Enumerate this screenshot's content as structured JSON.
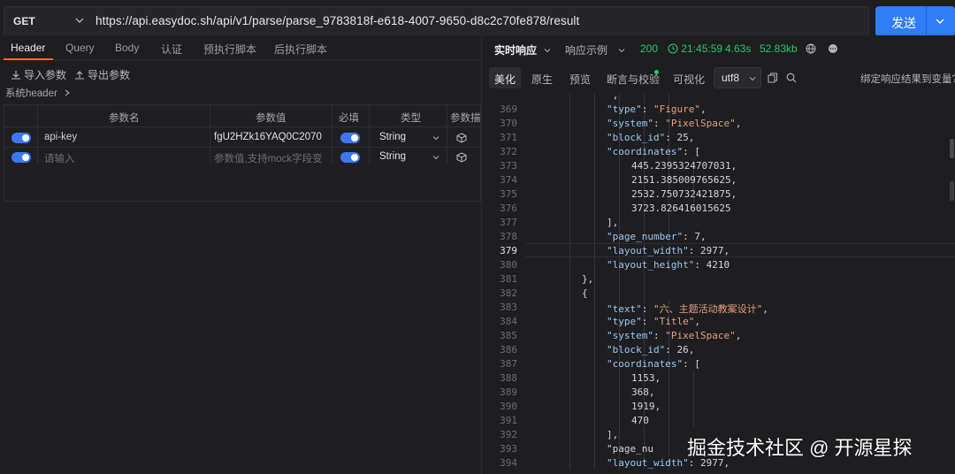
{
  "request": {
    "method": "GET",
    "url": "https://api.easydoc.sh/api/v1/parse/parse_9783818f-e618-4007-9650-d8c2c70fe878/result",
    "send_label": "发送"
  },
  "request_tabs": [
    "Header",
    "Query",
    "Body",
    "认证",
    "预执行脚本",
    "后执行脚本"
  ],
  "tools": {
    "import": "导入参数",
    "export": "导出参数"
  },
  "system_header": "系统header",
  "params_table": {
    "headers": [
      "参数名",
      "参数值",
      "必填",
      "类型",
      "参数描"
    ],
    "rows": [
      {
        "name": "api-key",
        "value": "fgU2HZk16YAQ0C2070",
        "required": true,
        "type": "String"
      },
      {
        "name": "请输入",
        "value": "参数值,支持mock字段变",
        "required": true,
        "type": "String"
      }
    ]
  },
  "response": {
    "mode": "实时响应",
    "example": "响应示例",
    "status": "200",
    "time": "21:45:59",
    "duration": "4.63s",
    "size": "52.83kb"
  },
  "view_tabs": [
    "美化",
    "原生",
    "预览",
    "断言与校验",
    "可视化"
  ],
  "encoding": "utf8",
  "bind_label": "绑定响应结果到变量?",
  "code": {
    "current_line": "379",
    "lines": [
      {
        "n": "",
        "t": "\","
      },
      {
        "n": "369",
        "t": "\"type\": \"Figure\","
      },
      {
        "n": "370",
        "t": "\"system\": \"PixelSpace\","
      },
      {
        "n": "371",
        "t": "\"block_id\": 25,"
      },
      {
        "n": "372",
        "t": "\"coordinates\": ["
      },
      {
        "n": "373",
        "t": "445.2395324707031,"
      },
      {
        "n": "374",
        "t": "2151.385009765625,"
      },
      {
        "n": "375",
        "t": "2532.750732421875,"
      },
      {
        "n": "376",
        "t": "3723.826416015625"
      },
      {
        "n": "377",
        "t": "],"
      },
      {
        "n": "378",
        "t": "\"page_number\": 7,"
      },
      {
        "n": "379",
        "t": "\"layout_width\": 2977,"
      },
      {
        "n": "380",
        "t": "\"layout_height\": 4210"
      },
      {
        "n": "381",
        "t": "},"
      },
      {
        "n": "382",
        "t": "{"
      },
      {
        "n": "383",
        "t": "\"text\": \"六、主题活动教案设计\","
      },
      {
        "n": "384",
        "t": "\"type\": \"Title\","
      },
      {
        "n": "385",
        "t": "\"system\": \"PixelSpace\","
      },
      {
        "n": "386",
        "t": "\"block_id\": 26,"
      },
      {
        "n": "387",
        "t": "\"coordinates\": ["
      },
      {
        "n": "388",
        "t": "1153,"
      },
      {
        "n": "389",
        "t": "368,"
      },
      {
        "n": "390",
        "t": "1919,"
      },
      {
        "n": "391",
        "t": "470"
      },
      {
        "n": "392",
        "t": "],"
      },
      {
        "n": "393",
        "t": "\"page_nu"
      },
      {
        "n": "394",
        "t": "\"layout_width\": 2977,"
      }
    ]
  },
  "watermark": "掘金技术社区 @ 开源星探",
  "colors": {
    "accent": "#2f7cf6",
    "tab_active": "#ff6a2a",
    "status_ok": "#2fc46a"
  }
}
